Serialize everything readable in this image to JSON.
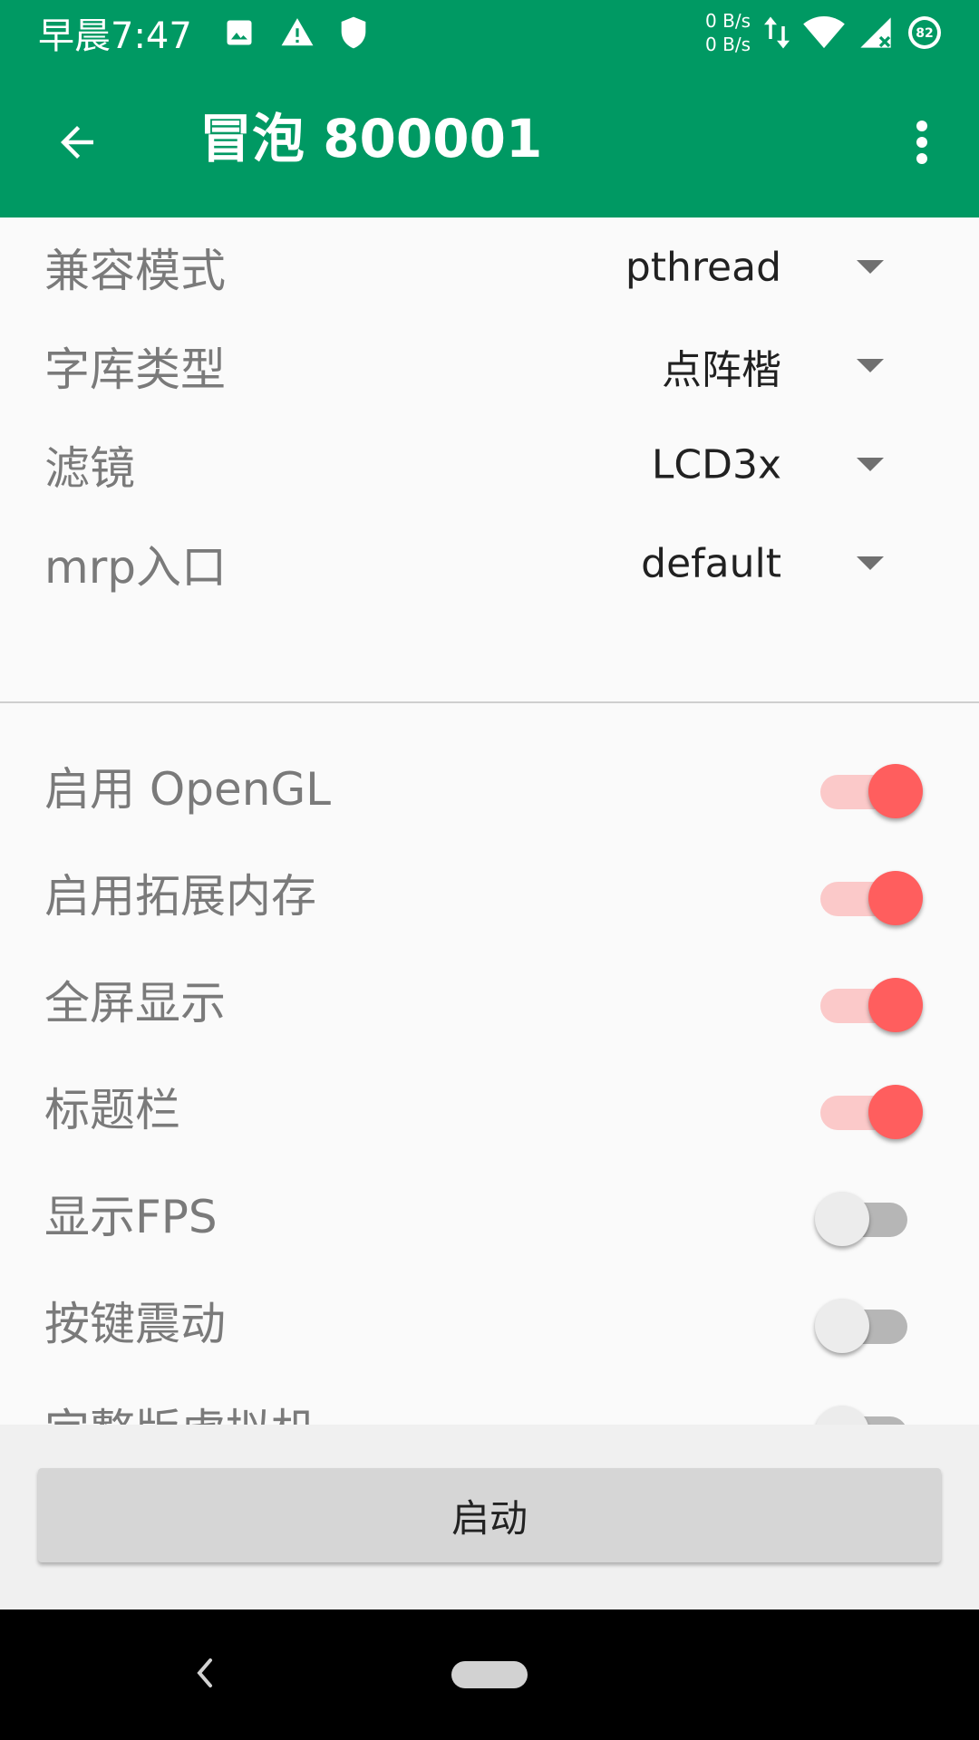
{
  "status_bar": {
    "time": "早晨7:47",
    "net_up": "0 B/s",
    "net_down": "0 B/s",
    "battery_level": "82"
  },
  "app_bar": {
    "title": "冒泡 800001",
    "color": "#009963"
  },
  "settings": {
    "dropdowns": [
      {
        "label": "兼容模式",
        "value": "pthread"
      },
      {
        "label": "字库类型",
        "value": "点阵楷"
      },
      {
        "label": "滤镜",
        "value": "LCD3x"
      },
      {
        "label": "mrp入口",
        "value": "default"
      }
    ],
    "toggles": [
      {
        "label": "启用 OpenGL",
        "on": true
      },
      {
        "label": "启用拓展内存",
        "on": true
      },
      {
        "label": "全屏显示",
        "on": true
      },
      {
        "label": "标题栏",
        "on": true
      },
      {
        "label": "显示FPS",
        "on": false
      },
      {
        "label": "按键震动",
        "on": false
      },
      {
        "label": "完整版虚拟机",
        "on": false
      }
    ],
    "switch_on_color": "#ff5e5e"
  },
  "actions": {
    "start_label": "启动"
  }
}
